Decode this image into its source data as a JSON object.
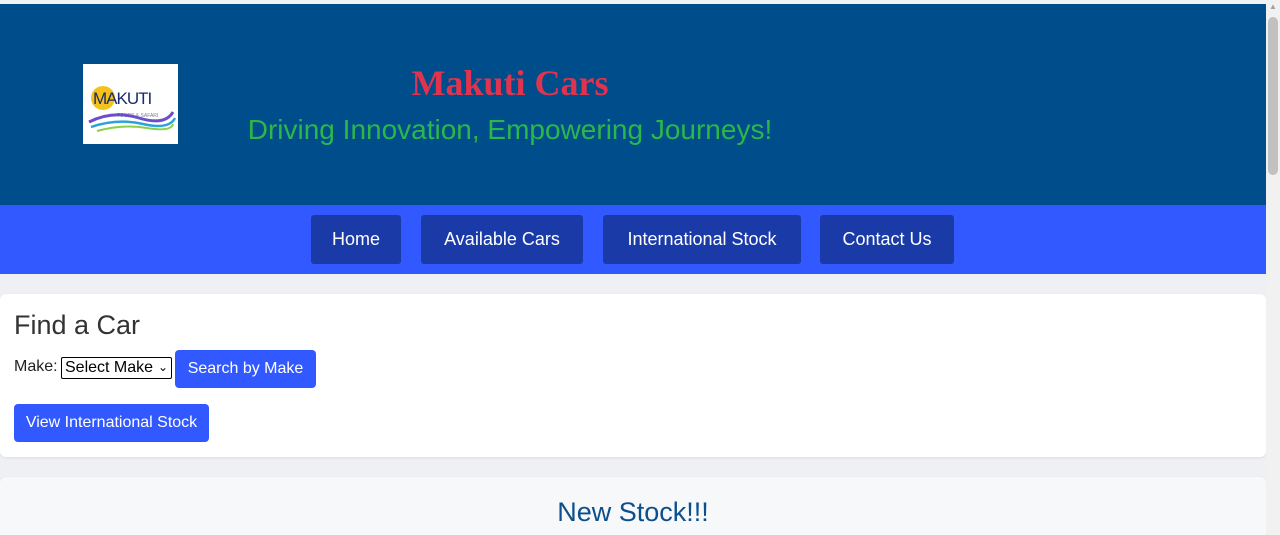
{
  "header": {
    "logo_text": "MAKUTI",
    "logo_subtext": "TOURS & SAFARI",
    "title": "Makuti Cars",
    "tagline": "Driving Innovation, Empowering Journeys!"
  },
  "nav": {
    "items": [
      "Home",
      "Available Cars",
      "International Stock",
      "Contact Us"
    ]
  },
  "find_car": {
    "heading": "Find a Car",
    "make_label": "Make:",
    "make_selected": "Select Make",
    "search_button": "Search by Make",
    "international_button": "View International Stock"
  },
  "new_stock": {
    "heading": "New Stock!!!"
  },
  "colors": {
    "header_bg": "#004d8c",
    "title": "#e0334d",
    "tagline": "#2bb74a",
    "nav_bg": "#3159ff",
    "nav_button": "#1a3aa8",
    "button": "#3159ff"
  }
}
